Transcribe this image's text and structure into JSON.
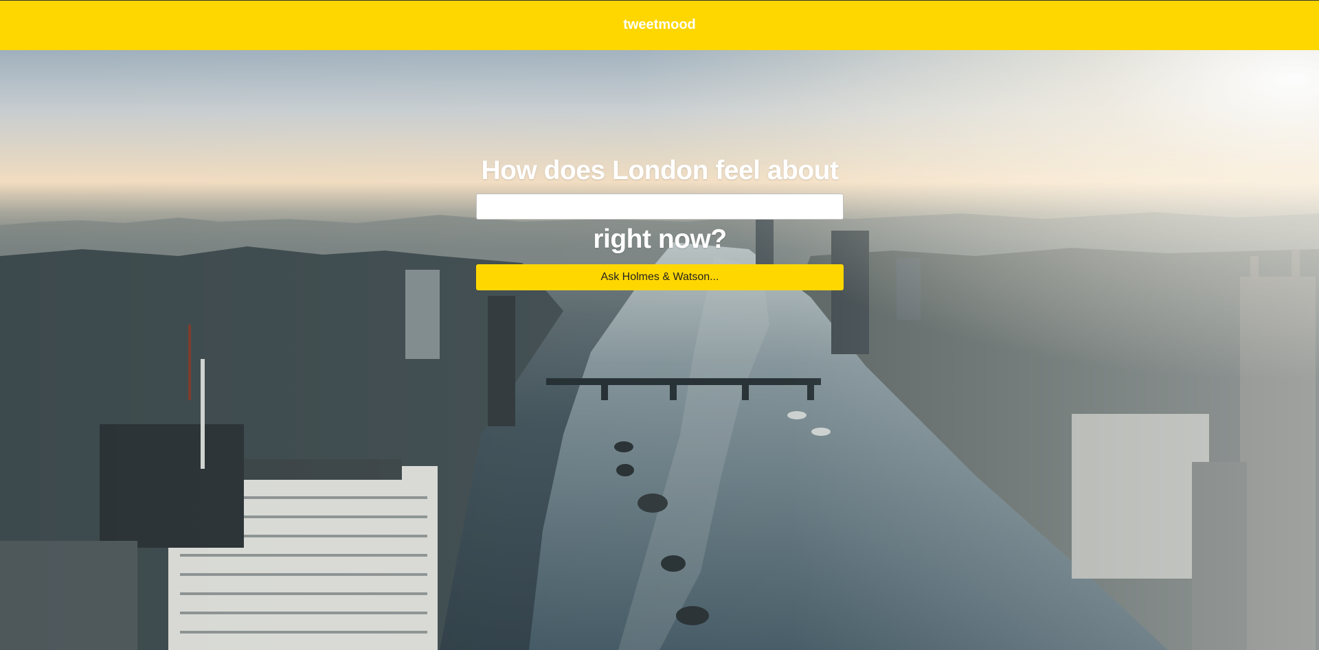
{
  "navbar": {
    "brand": "tweetmood"
  },
  "hero": {
    "headline_before": "How does London feel about",
    "topic_input_value": "",
    "headline_after": "right now?",
    "ask_button_label": "Ask Holmes & Watson...",
    "background_image": "london-thames-aerial-photo"
  },
  "colors": {
    "accent": "#ffd700",
    "text_on_hero": "#ffffff"
  }
}
